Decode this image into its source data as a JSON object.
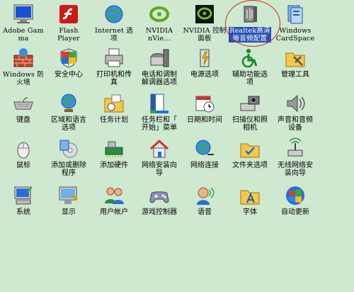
{
  "window": {
    "background_color": "#cfe8d0",
    "selection_color": "#2a4fb5"
  },
  "items": [
    {
      "label": "Adobe Gamma",
      "icon": "monitor-icon"
    },
    {
      "label": "Flash\nPlayer",
      "icon": "flash-icon"
    },
    {
      "label": "Internet 选\n项",
      "icon": "globe-icon"
    },
    {
      "label": "NVIDIA\nnVie...",
      "icon": "nvidia-icon"
    },
    {
      "label": "NVIDIA 控制\n面板",
      "icon": "nvidia-panel-icon"
    },
    {
      "label": "Realtek高清\n晰音频配置",
      "icon": "speaker-icon"
    },
    {
      "label": "Windows\nCardSpace",
      "icon": "cardspace-icon"
    },
    {
      "label": "Windows 防\n火墙",
      "icon": "firewall-icon"
    },
    {
      "label": "安全中心",
      "icon": "shield-icon"
    },
    {
      "label": "打印机和传\n真",
      "icon": "printer-icon"
    },
    {
      "label": "电话和调制\n解调器选项",
      "icon": "phone-icon"
    },
    {
      "label": "电源选项",
      "icon": "power-icon"
    },
    {
      "label": "辅助功能选\n项",
      "icon": "accessibility-icon"
    },
    {
      "label": "管理工具",
      "icon": "admin-tools-icon"
    },
    {
      "label": "键盘",
      "icon": "keyboard-icon"
    },
    {
      "label": "区域和语言\n选项",
      "icon": "region-globe-icon"
    },
    {
      "label": "任务计划",
      "icon": "task-folder-icon"
    },
    {
      "label": "任务栏和「\n开始」菜单",
      "icon": "taskbar-icon"
    },
    {
      "label": "日期和时间",
      "icon": "calendar-clock-icon"
    },
    {
      "label": "扫描仪和照\n相机",
      "icon": "scanner-camera-icon"
    },
    {
      "label": "声音和音频\n设备",
      "icon": "sound-icon"
    },
    {
      "label": "鼠标",
      "icon": "mouse-icon"
    },
    {
      "label": "添加或删除\n程序",
      "icon": "add-remove-icon"
    },
    {
      "label": "添加硬件",
      "icon": "hardware-icon"
    },
    {
      "label": "网络安装向\n导",
      "icon": "network-home-icon"
    },
    {
      "label": "网络连接",
      "icon": "network-globe-icon"
    },
    {
      "label": "文件夹选项",
      "icon": "folder-options-icon"
    },
    {
      "label": "无线网络安\n装向导",
      "icon": "wireless-icon"
    },
    {
      "label": "系统",
      "icon": "system-icon"
    },
    {
      "label": "显示",
      "icon": "display-icon"
    },
    {
      "label": "用户帐户",
      "icon": "users-icon"
    },
    {
      "label": "游戏控制器",
      "icon": "gamepad-icon"
    },
    {
      "label": "语音",
      "icon": "speech-icon"
    },
    {
      "label": "字体",
      "icon": "fonts-folder-icon"
    },
    {
      "label": "自动更新",
      "icon": "windows-update-icon"
    }
  ]
}
